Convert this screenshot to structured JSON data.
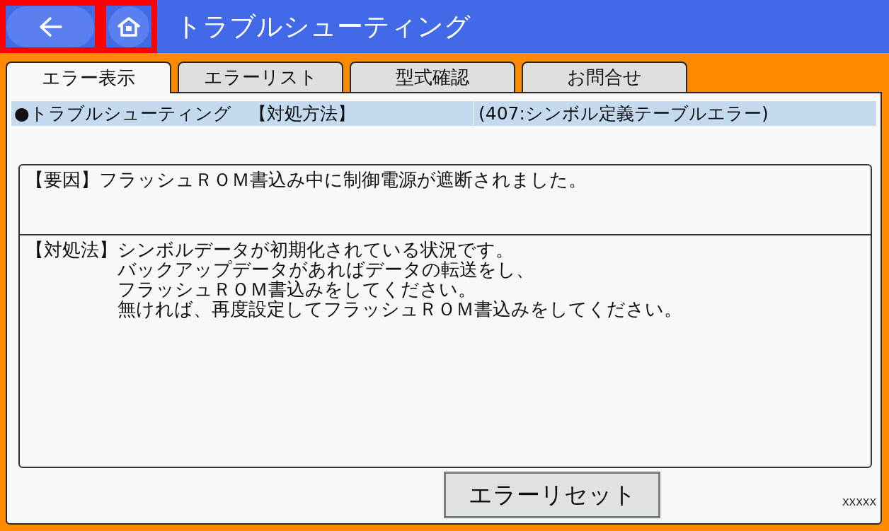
{
  "header": {
    "buttons": [
      {
        "kind": "back",
        "highlighted": true
      },
      {
        "kind": "home",
        "highlighted": true
      }
    ],
    "title": "トラブルシューティング"
  },
  "tabs": [
    {
      "label": "エラー表示",
      "selected": true
    },
    {
      "label": "エラーリスト",
      "selected": false
    },
    {
      "label": "型式確認",
      "selected": false
    },
    {
      "label": "お問合せ",
      "selected": false
    }
  ],
  "heading": {
    "title": "●トラブルシューティング　【対処方法】",
    "code": "(407:シンボル定義テーブルエラー)"
  },
  "sections": [
    {
      "label": "【要因】",
      "lines": [
        "フラッシュＲＯＭ書込み中に制御電源が遮断されました。"
      ]
    },
    {
      "label": "【対処法】",
      "lines": [
        "シンボルデータが初期化されている状況です。",
        "バックアップデータがあればデータの転送をし、",
        "フラッシュＲＯＭ書込みをしてください。",
        "無ければ、再度設定してフラッシュＲＯＭ書込みをしてください。"
      ]
    }
  ],
  "action_button": "エラーリセット",
  "footer_code": "XXXXX"
}
